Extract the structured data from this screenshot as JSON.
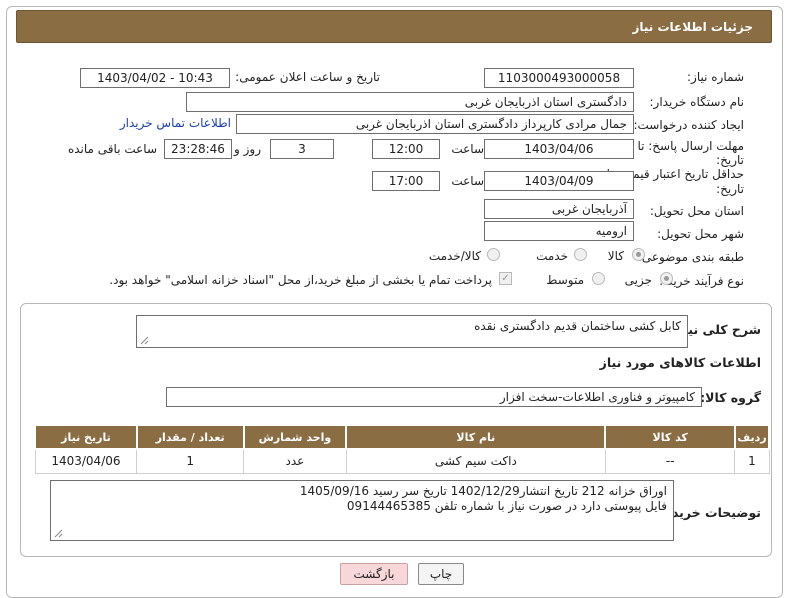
{
  "header": {
    "title": "جزئیات اطلاعات نیاز"
  },
  "form": {
    "need_number": {
      "label": "شماره نیاز:",
      "value": "1103000493000058"
    },
    "announce": {
      "label": "تاریخ و ساعت اعلان عمومی:",
      "value": "1403/04/02 - 10:43"
    },
    "buyer_org": {
      "label": "نام دستگاه خریدار:",
      "value": "دادگستری استان اذربایجان غربی"
    },
    "requester": {
      "label": "ایجاد کننده درخواست:",
      "value": "جمال مرادی کارپرداز دادگستری استان اذربایجان غربی",
      "contact_link": "اطلاعات تماس خریدار"
    },
    "reply_deadline": {
      "label_line1": "مهلت ارسال پاسخ: تا",
      "label_line2": "تاریخ:",
      "date": "1403/04/06",
      "time_label": "ساعت",
      "time": "12:00",
      "days": "3",
      "days_label": "روز و",
      "remaining": "23:28:46",
      "remaining_label": "ساعت باقی مانده"
    },
    "price_validity": {
      "label_line1": "حداقل تاریخ اعتبار قیمت: تا",
      "label_line2": "تاریخ:",
      "date": "1403/04/09",
      "time_label": "ساعت",
      "time": "17:00"
    },
    "delivery_province": {
      "label": "استان محل تحویل:",
      "value": "آذربایجان غربی"
    },
    "delivery_city": {
      "label": "شهر محل تحویل:",
      "value": "ارومیه"
    },
    "category": {
      "label": "طبقه بندی موضوعی:",
      "options": [
        "کالا",
        "خدمت",
        "کالا/خدمت"
      ],
      "selected": "کالا"
    },
    "purchase_process": {
      "label": "نوع فرآیند خرید :",
      "options": [
        "جزیی",
        "متوسط"
      ],
      "selected": "جزیی",
      "payment_note": "پرداخت تمام یا بخشی از مبلغ خرید،از محل \"اسناد خزانه اسلامی\" خواهد بود."
    }
  },
  "details": {
    "summary_label": "شرح کلی نیاز:",
    "summary_value": "کابل کشی ساختمان قدیم دادگستری نقده",
    "goods_info_title": "اطلاعات کالاهای مورد نیاز",
    "goods_group_label": "گروه کالا:",
    "goods_group_value": "کامپیوتر و فناوری اطلاعات-سخت افزار",
    "table": {
      "headers": [
        "ردیف",
        "کد کالا",
        "نام کالا",
        "واحد شمارش",
        "تعداد / مقدار",
        "تاریخ نیاز"
      ],
      "rows": [
        [
          "1",
          "--",
          "داکت سیم کشی",
          "عدد",
          "1",
          "1403/04/06"
        ]
      ]
    },
    "buyer_notes_label": "توضیحات خریدار:",
    "buyer_notes_line1": "اوراق خزانه 212  تاریخ انتشار1402/12/29 تاریخ سر رسید 1405/09/16",
    "buyer_notes_line2": "فایل پیوستی دارد در صورت نیاز با شماره تلفن 09144465385"
  },
  "buttons": {
    "print": "چاپ",
    "back": "بازگشت"
  },
  "colors": {
    "header_bg": "#8b6d44",
    "table_header_bg": "#8b6d44",
    "link": "#1a3fb0",
    "back_button_bg": "#f7d7d7"
  }
}
